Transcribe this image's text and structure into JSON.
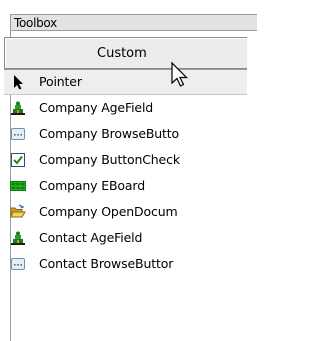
{
  "toolbox": {
    "title": "Toolbox",
    "tab_label": "Custom",
    "items": [
      {
        "label": "Pointer",
        "icon": "pointer-arrow-icon"
      },
      {
        "label": "Company AgeField",
        "icon": "age-field-icon"
      },
      {
        "label": "Company BrowseButto",
        "icon": "browse-button-icon"
      },
      {
        "label": "Company ButtonCheck",
        "icon": "checkbox-icon"
      },
      {
        "label": "Company EBoard",
        "icon": "eboard-icon"
      },
      {
        "label": "Company OpenDocum",
        "icon": "open-folder-icon"
      },
      {
        "label": "Contact AgeField",
        "icon": "age-field-icon"
      },
      {
        "label": "Contact BrowseButtor",
        "icon": "browse-button-icon"
      }
    ]
  }
}
